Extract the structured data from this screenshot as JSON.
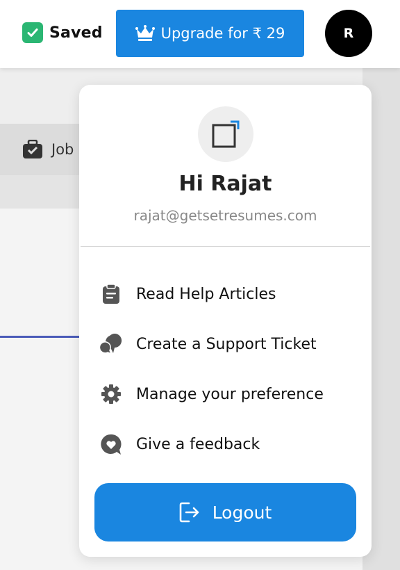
{
  "topbar": {
    "saved_label": "Saved",
    "upgrade_label": "Upgrade for ₹ 29",
    "avatar_initial": "R"
  },
  "background": {
    "jobs_tab_label": "Job"
  },
  "user_menu": {
    "greeting": "Hi Rajat",
    "email": "rajat@getsetresumes.com",
    "items": [
      {
        "label": "Read Help Articles",
        "icon": "clipboard-icon"
      },
      {
        "label": "Create a Support Ticket",
        "icon": "chat-bubbles-icon"
      },
      {
        "label": "Manage your preference",
        "icon": "gear-icon"
      },
      {
        "label": "Give a feedback",
        "icon": "heart-chat-icon"
      }
    ],
    "logout_label": "Logout"
  },
  "colors": {
    "primary": "#1a86e0",
    "saved_green": "#2bb673",
    "avatar_bg": "#000000",
    "icon_gray": "#555555"
  }
}
